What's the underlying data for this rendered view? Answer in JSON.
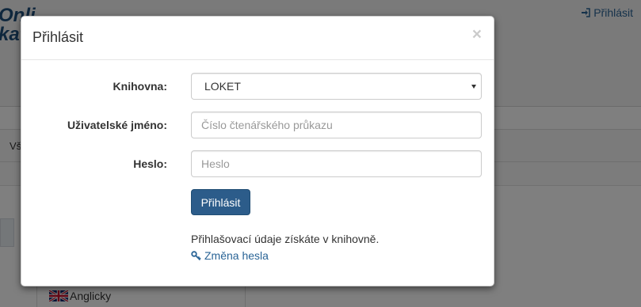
{
  "background": {
    "logo_text": "Onli\nkat",
    "login_link": "Přihlásit",
    "tab_label": "Vš",
    "list_item": "Anglicky"
  },
  "modal": {
    "title": "Přihlásit",
    "close_symbol": "×",
    "library_label": "Knihovna:",
    "library_value": "LOKET",
    "username_label": "Uživatelské jméno:",
    "username_placeholder": "Číslo čtenářského průkazu",
    "password_label": "Heslo:",
    "password_placeholder": "Heslo",
    "submit_label": "Přihlásit",
    "info_text": "Přihlašovací údaje získáte v knihovně.",
    "change_password_link": "Změna hesla"
  },
  "colors": {
    "primary_button": "#2c5c8a",
    "link": "#2a6496",
    "overlay": "rgba(0,0,0,0.5)"
  },
  "icons": {
    "login": "sign-in-icon",
    "key": "key-icon",
    "flag": "uk-flag-icon",
    "close": "close-icon"
  }
}
